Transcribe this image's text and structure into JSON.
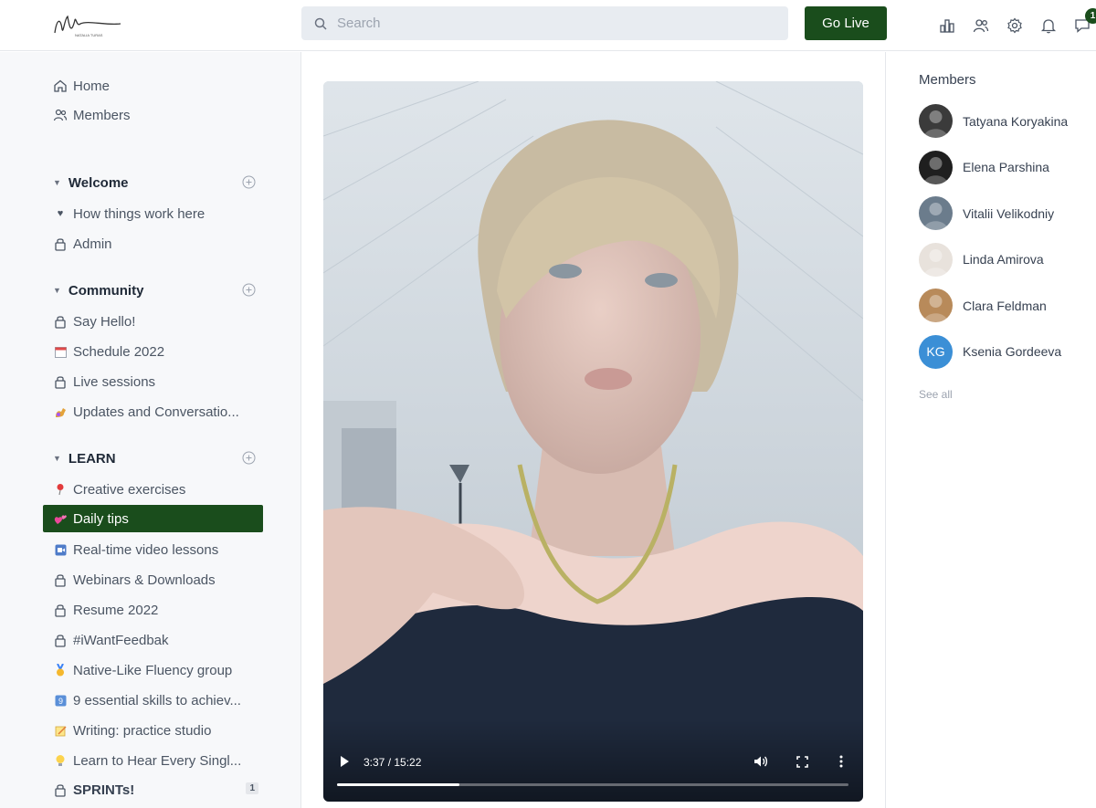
{
  "header": {
    "logo_alt": "Natalia Turas",
    "search_placeholder": "Search",
    "go_live_label": "Go Live",
    "messages_badge": "1"
  },
  "sidebar": {
    "top_items": [
      {
        "label": "Home",
        "icon": "home-icon"
      },
      {
        "label": "Members",
        "icon": "users-icon"
      }
    ],
    "sections": [
      {
        "title": "Welcome",
        "items": [
          {
            "label": "How things work here",
            "icon": "heart-icon"
          },
          {
            "label": "Admin",
            "icon": "lock-icon"
          }
        ]
      },
      {
        "title": "Community",
        "items": [
          {
            "label": "Say Hello!",
            "icon": "lock-icon"
          },
          {
            "label": "Schedule 2022",
            "icon": "calendar-emoji"
          },
          {
            "label": "Live sessions",
            "icon": "lock-icon"
          },
          {
            "label": "Updates and Conversatio...",
            "icon": "flex-emoji"
          }
        ]
      },
      {
        "title": "LEARN",
        "items": [
          {
            "label": "Creative exercises",
            "icon": "pushpin-emoji"
          },
          {
            "label": "Daily tips",
            "icon": "hearts-emoji",
            "active": true
          },
          {
            "label": "Real-time video lessons",
            "icon": "film-emoji"
          },
          {
            "label": "Webinars & Downloads",
            "icon": "lock-icon"
          },
          {
            "label": "Resume 2022",
            "icon": "lock-icon"
          },
          {
            "label": "#iWantFeedbak",
            "icon": "lock-icon"
          },
          {
            "label": "Native-Like Fluency group",
            "icon": "medal-emoji"
          },
          {
            "label": "9 essential skills to achiev...",
            "icon": "nine-emoji"
          },
          {
            "label": "Writing: practice studio",
            "icon": "memo-emoji"
          },
          {
            "label": "Learn to Hear Every Singl...",
            "icon": "bulb-emoji"
          },
          {
            "label": "SPRINTs!",
            "icon": "lock-icon",
            "count": "1"
          }
        ]
      }
    ]
  },
  "video": {
    "time": "3:37 / 15:22",
    "progress": 0.24
  },
  "members": {
    "title": "Members",
    "list": [
      {
        "name": "Tatyana Koryakina",
        "color": "#3b3b3b"
      },
      {
        "name": "Elena Parshina",
        "color": "#1f1f1f"
      },
      {
        "name": "Vitalii Velikodniy",
        "color": "#6b7c8c"
      },
      {
        "name": "Linda Amirova",
        "color": "#e8e2dc"
      },
      {
        "name": "Clara Feldman",
        "color": "#b88a5a"
      },
      {
        "name": "Ksenia Gordeeva",
        "initials": "KG",
        "color": "#3b8fd6"
      }
    ],
    "see_all": "See all"
  },
  "colors": {
    "brand": "#1a4d1c",
    "sidebar_bg": "#f7f8fa"
  }
}
